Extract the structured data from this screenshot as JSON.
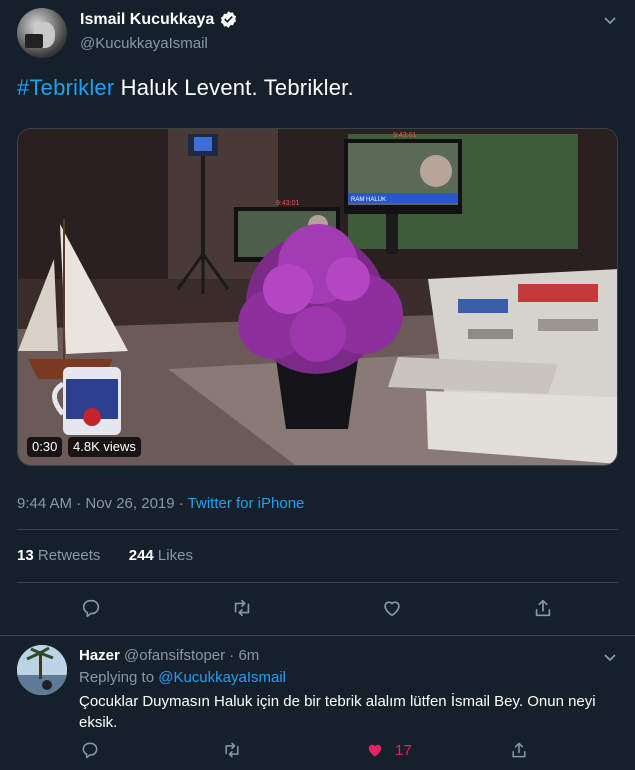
{
  "tweet": {
    "author_name": "Ismail Kucukkaya",
    "handle": "@KucukkayaIsmail",
    "hashtag": "#Tebrikler",
    "text_rest": " Haluk Levent. Tebrikler.",
    "video": {
      "duration": "0:30",
      "views": "4.8K views",
      "monitor_time": "9:43:01",
      "monitor_ticker": "RAM HALUK"
    },
    "time_date": "9:44 AM · Nov 26, 2019 · ",
    "source": "Twitter for iPhone",
    "retweets_count": "13",
    "retweets_label": " Retweets",
    "likes_count": "244",
    "likes_label": " Likes",
    "icons": [
      "verified-badge-icon",
      "chevron-down-icon",
      "reply-icon",
      "retweet-icon",
      "like-icon",
      "share-icon"
    ]
  },
  "reply": {
    "author_name": "Hazer",
    "handle_time": " @ofansifstoper · 6m",
    "replying_prefix": "Replying to ",
    "replying_handle": "@KucukkayaIsmail",
    "text": "Çocuklar Duymasın Haluk için de bir tebrik alalım lütfen İsmail Bey. Onun neyi eksik.",
    "like_count": "17",
    "liked": true
  },
  "colors": {
    "background": "#15202b",
    "accent": "#1da1f2",
    "secondary_text": "#8899a6",
    "divider": "#38444d",
    "like_active": "#e0245e"
  }
}
